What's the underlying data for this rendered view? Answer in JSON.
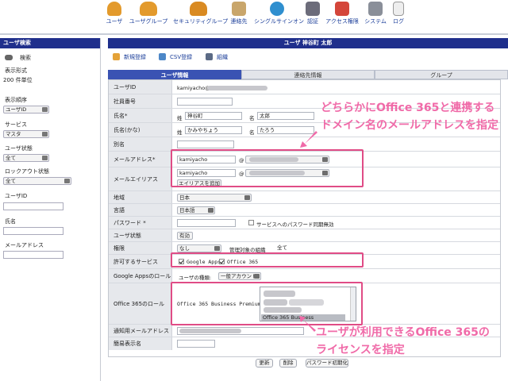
{
  "toolbar": {
    "items": [
      {
        "label": "ユーザ",
        "icon": "user-icon"
      },
      {
        "label": "ユーザグループ",
        "icon": "user-group-icon"
      },
      {
        "label": "セキュリティグループ",
        "icon": "security-group-icon"
      },
      {
        "label": "連絡先",
        "icon": "contacts-icon"
      },
      {
        "label": "シングルサインオン",
        "icon": "globe-icon"
      },
      {
        "label": "認証",
        "icon": "auth-icon"
      },
      {
        "label": "アクセス権限",
        "icon": "access-icon"
      },
      {
        "label": "システム",
        "icon": "tools-icon"
      },
      {
        "label": "ログ",
        "icon": "log-icon"
      }
    ]
  },
  "sidebar": {
    "title": "ユーザ検索",
    "search_label": "検索",
    "display_format_label": "表示形式",
    "display_format_value": "200 件単位",
    "sort_order_label": "表示順序",
    "sort_order_value": "ユーザID",
    "service_label": "サービス",
    "service_value": "マスタ",
    "user_status_label": "ユーザ状態",
    "user_status_value": "全て",
    "lockout_label": "ロックアウト状態",
    "lockout_value": "全て",
    "user_id_label": "ユーザID",
    "name_label": "氏名",
    "email_label": "メールアドレス"
  },
  "main": {
    "title": "ユーザ 神谷町 太郎",
    "actions": {
      "new": "新規登録",
      "csv": "CSV登録",
      "org": "組織"
    },
    "tabs": [
      "ユーザ情報",
      "連絡先情報",
      "グループ"
    ],
    "rows": {
      "user_id": {
        "label": "ユーザID",
        "value": "kamiyacho@"
      },
      "employee_no": {
        "label": "社員番号"
      },
      "name": {
        "label": "氏名*",
        "sei": "姓",
        "sei_value": "神谷町",
        "mei": "名",
        "mei_value": "太郎"
      },
      "name_kana": {
        "label": "氏名(かな)",
        "sei": "姓",
        "sei_value": "かみやちょう",
        "mei": "名",
        "mei_value": "たろう"
      },
      "alias": {
        "label": "別名"
      },
      "email": {
        "label": "メールアドレス*",
        "local": "kamiyacho",
        "at": "@"
      },
      "email_alias": {
        "label": "メールエイリアス",
        "local": "kamiyacho",
        "at": "@",
        "add_button": "エイリアスを追加"
      },
      "region": {
        "label": "地域",
        "value": "日本"
      },
      "language": {
        "label": "言語",
        "value": "日本語"
      },
      "password": {
        "label": "パスワード *",
        "sync_label": "サービスへのパスワード同期無効"
      },
      "user_status": {
        "label": "ユーザ状態",
        "value": "有効"
      },
      "authority": {
        "label": "権限",
        "value": "なし",
        "managed_org_label": "管理対象の組織",
        "managed_org_value": "全て"
      },
      "allowed_services": {
        "label": "許可するサービス",
        "google": "Google Apps",
        "office": "Office 365"
      },
      "google_role": {
        "label": "Google Appsのロール",
        "type_label": "ユーザの種類:",
        "type_value": "一般アカウント"
      },
      "office_role": {
        "label": "Office 365のロール",
        "plan_label": "Office 365 Business Premium:",
        "option_selected": "Office 365 Business"
      },
      "notify_email": {
        "label": "通知用メールアドレス"
      },
      "display_name": {
        "label": "簡易表示名"
      }
    },
    "buttons": {
      "update": "更新",
      "delete": "削除",
      "reset_password": "パスワード初期化"
    }
  },
  "annotations": {
    "top_line1": "どちらかにOffice 365と連携する",
    "top_line2": "ドメイン名のメールアドレスを指定",
    "bottom_line1": "ユーザが利用できるOffice 365の",
    "bottom_line2": "ライセンスを指定",
    "color": "#f06aa8"
  }
}
